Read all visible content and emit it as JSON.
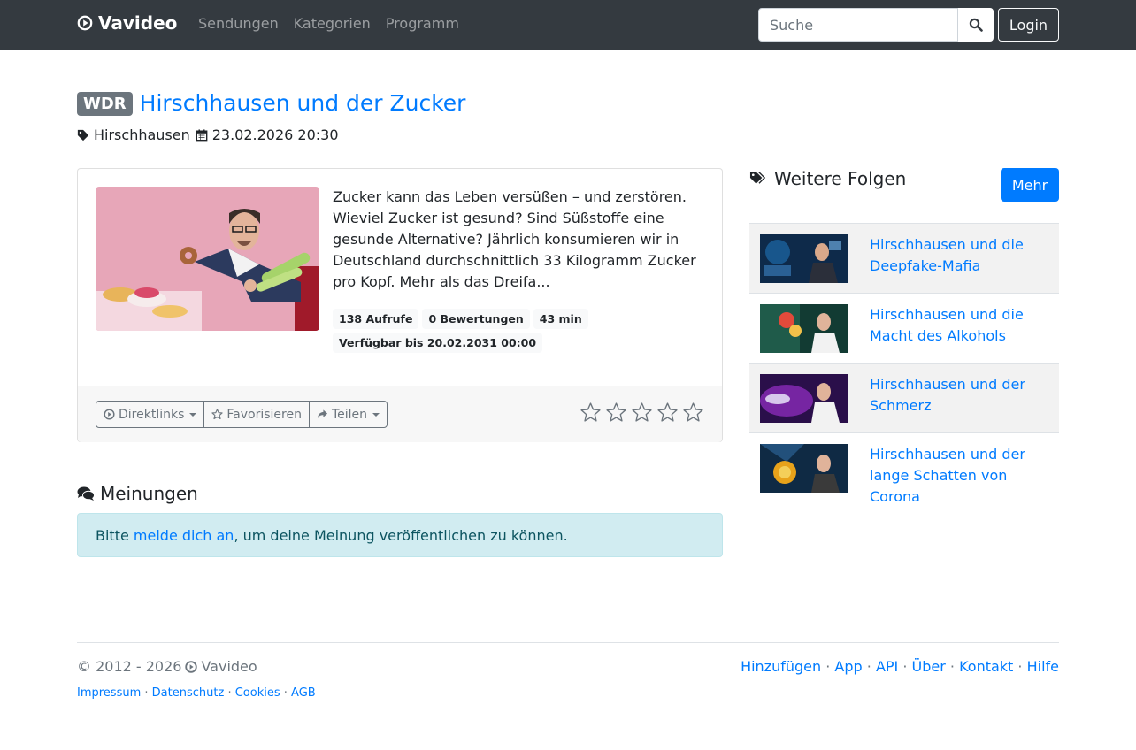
{
  "navbar": {
    "brand": "Vavideo",
    "links": [
      "Sendungen",
      "Kategorien",
      "Programm"
    ],
    "search_placeholder": "Suche",
    "login_label": "Login"
  },
  "episode": {
    "channel": "WDR",
    "title": "Hirschhausen und der Zucker",
    "show": "Hirschhausen",
    "datetime": "23.02.2026 20:30",
    "description": "Zucker kann das Leben versüßen – und zerstören. Wieviel Zucker ist gesund? Sind Süßstoffe eine gesunde Alternative? Jährlich konsumieren wir in Deutschland durchschnittlich 33 Kilogramm Zucker pro Kopf. Mehr als das Dreifa...",
    "views": "138 Aufrufe",
    "ratings": "0 Bewertungen",
    "duration": "43 min",
    "available_until": "Verfügbar bis 20.02.2031 00:00",
    "rating_stars": 0,
    "rating_max": 5
  },
  "actions": {
    "direct_links": "Direktlinks",
    "favorite": "Favorisieren",
    "share": "Teilen"
  },
  "opinions": {
    "heading": "Meinungen",
    "prefix": "Bitte ",
    "login_link": "melde dich an",
    "suffix": ", um deine Meinung veröffentlichen zu können."
  },
  "sidebar": {
    "heading": "Weitere Folgen",
    "more_label": "Mehr",
    "items": [
      {
        "title": "Hirschhausen und die Deepfake-Mafia"
      },
      {
        "title": "Hirschhausen und die Macht des Alkohols"
      },
      {
        "title": "Hirschhausen und der Schmerz"
      },
      {
        "title": "Hirschhausen und der lange Schatten von Corona"
      }
    ]
  },
  "footer": {
    "copyright": "© 2012 - 2026",
    "brand": "Vavideo",
    "legal": [
      "Impressum",
      "Datenschutz",
      "Cookies",
      "AGB"
    ],
    "links": [
      "Hinzufügen",
      "App",
      "API",
      "Über",
      "Kontakt",
      "Hilfe"
    ]
  }
}
